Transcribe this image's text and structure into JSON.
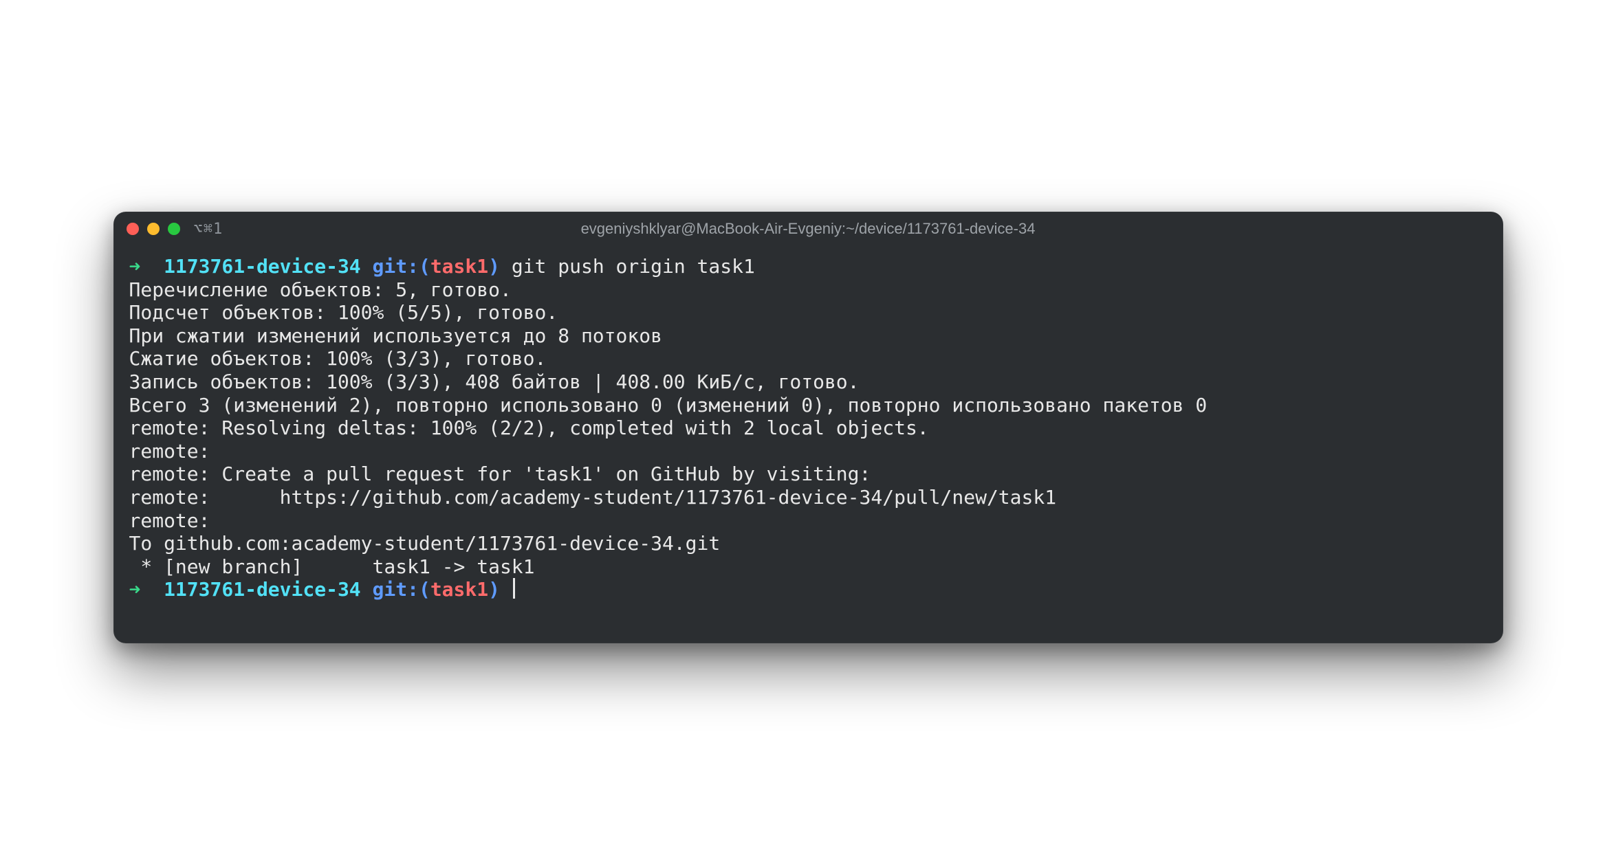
{
  "titlebar": {
    "tab_label": "⌥⌘1",
    "title": "evgeniyshklyar@MacBook-Air-Evgeniy:~/device/1173761-device-34"
  },
  "prompt1": {
    "arrow": "➜",
    "dir": "1173761-device-34",
    "git_prefix": "git:(",
    "branch": "task1",
    "git_suffix": ")",
    "command": "git push origin task1"
  },
  "output": {
    "l1": "Перечисление объектов: 5, готово.",
    "l2": "Подсчет объектов: 100% (5/5), готово.",
    "l3": "При сжатии изменений используется до 8 потоков",
    "l4": "Сжатие объектов: 100% (3/3), готово.",
    "l5": "Запись объектов: 100% (3/3), 408 байтов | 408.00 КиБ/с, готово.",
    "l6": "Всего 3 (изменений 2), повторно использовано 0 (изменений 0), повторно использовано пакетов 0",
    "l7": "remote: Resolving deltas: 100% (2/2), completed with 2 local objects.",
    "l8": "remote:",
    "l9": "remote: Create a pull request for 'task1' on GitHub by visiting:",
    "l10": "remote:      https://github.com/academy-student/1173761-device-34/pull/new/task1",
    "l11": "remote:",
    "l12": "To github.com:academy-student/1173761-device-34.git",
    "l13": " * [new branch]      task1 -> task1"
  },
  "prompt2": {
    "arrow": "➜",
    "dir": "1173761-device-34",
    "git_prefix": "git:(",
    "branch": "task1",
    "git_suffix": ")"
  }
}
